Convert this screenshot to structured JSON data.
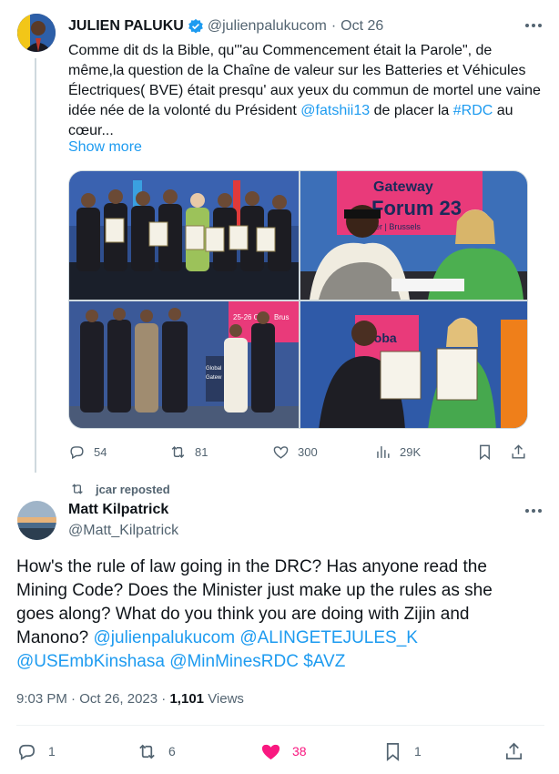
{
  "tweet1": {
    "author_name": "JULIEN PALUKU",
    "handle": "@julienpalukucom",
    "date": "Oct 26",
    "text_a": "Comme dit ds la Bible, qu'\"au Commencement était la Parole\", de même,la question de la Chaîne de valeur sur les Batteries et Véhicules Électriques( BVE) était presqu' aux yeux du commun de mortel une vaine idée née de la volonté du Président ",
    "mention": "@fatshii13",
    "text_b": " de placer la ",
    "hashtag": "#RDC",
    "text_c": " au cœur...",
    "show_more": "Show more",
    "photo_texts": {
      "banner_line1": "Gateway",
      "banner_line2": "Forum 23",
      "banner_line3": "er | Brussels",
      "backdrop_date": "25-26 Oc",
      "backdrop_city": "Brus",
      "side_word1": "Global",
      "side_word2": "Gatew",
      "sign_word": "Globa"
    },
    "stats": {
      "replies": "54",
      "reposts": "81",
      "likes": "300",
      "views": "29K"
    }
  },
  "repost": {
    "label": "jcar reposted"
  },
  "tweet2": {
    "author_name": "Matt Kilpatrick",
    "handle": "@Matt_Kilpatrick",
    "text": "How's the rule of law going in the DRC? Has anyone read the Mining Code? Does the Minister just make up the rules as she goes along? What do you think you are doing with Zijin and Manono? ",
    "mentions_line1": "@julienpalukucom @ALINGETEJULES_K",
    "mentions_line2": "@USEmbKinshasa @MinMinesRDC $AVZ",
    "time": "9:03 PM",
    "date": "Oct 26, 2023",
    "views_count": "1,101",
    "views_label": "Views",
    "stats": {
      "replies": "1",
      "reposts": "6",
      "likes": "38",
      "bookmarks": "1"
    }
  },
  "colors": {
    "accent": "#1d9bf0",
    "secondary_text": "#536471",
    "like_pink": "#f91880",
    "border": "#cfd9de"
  },
  "icons": [
    "verified-badge-icon",
    "more-icon",
    "reply-icon",
    "repost-icon",
    "like-icon",
    "views-icon",
    "bookmark-icon",
    "share-icon"
  ]
}
